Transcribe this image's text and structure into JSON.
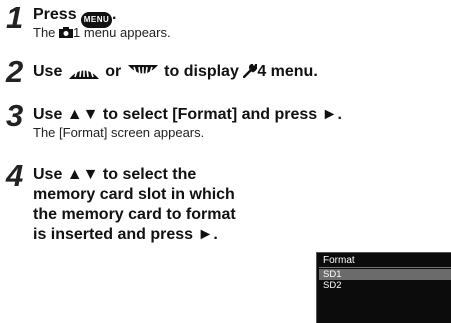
{
  "steps": [
    {
      "number": "1",
      "heading_prefix": "Press",
      "menu_key": "MENU",
      "heading_suffix": ".",
      "sub_prefix": "The",
      "sub_suffix": "1 menu appears."
    },
    {
      "number": "2",
      "heading_use": "Use",
      "heading_or": "or",
      "heading_to": "to display",
      "heading_menu": "4 menu."
    },
    {
      "number": "3",
      "heading": "Use ▲▼ to select [Format] and press ►.",
      "sub": "The [Format] screen appears."
    },
    {
      "number": "4",
      "lines": [
        "Use ▲▼ to select the",
        "memory card slot in which",
        "the memory card to format",
        "is inserted and press ►."
      ]
    }
  ],
  "lcd": {
    "title": "Format",
    "items": [
      "SD1",
      "SD2"
    ],
    "selected": "SD1"
  }
}
